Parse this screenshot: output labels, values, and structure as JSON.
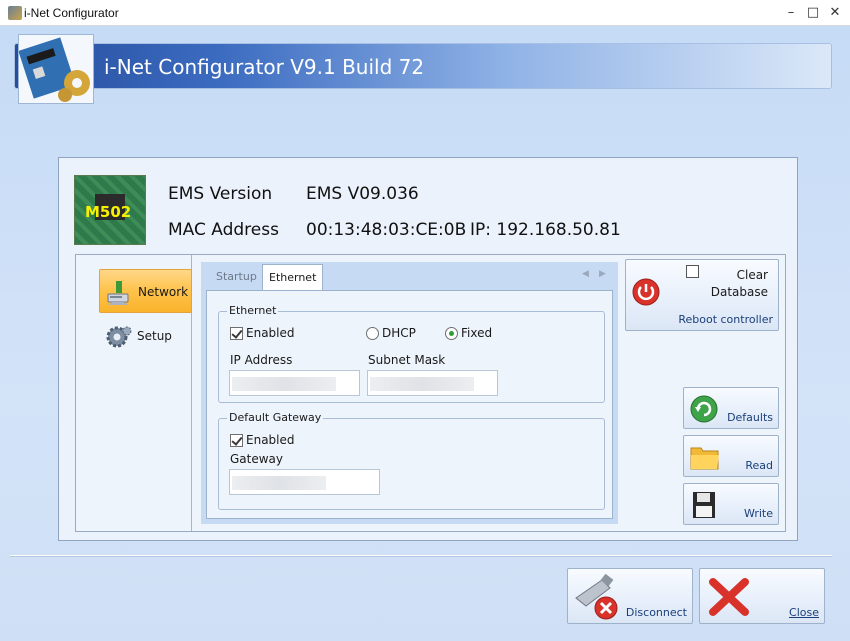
{
  "window": {
    "title": "i-Net Configurator",
    "min_glyph": "–",
    "max_glyph": "□",
    "close_glyph": "✕"
  },
  "banner": {
    "title": "i-Net Configurator V9.1 Build 72"
  },
  "device": {
    "board_label": "M502",
    "ems_version_label": "EMS Version",
    "ems_version_value": "EMS V09.036",
    "mac_label": "MAC Address",
    "mac_value": "00:13:48:03:CE:0B",
    "ip_text": "IP: 192.168.50.81"
  },
  "sidebar": {
    "items": [
      {
        "label": "Network",
        "icon": "network-icon",
        "selected": true
      },
      {
        "label": "Setup",
        "icon": "gear-icon",
        "selected": false
      }
    ]
  },
  "tabs": [
    {
      "label": "Startup",
      "active": false
    },
    {
      "label": "Ethernet",
      "active": true
    }
  ],
  "ethernet": {
    "group_title": "Ethernet",
    "enabled_label": "Enabled",
    "enabled": true,
    "dhcp_label": "DHCP",
    "fixed_label": "Fixed",
    "mode": "Fixed",
    "ip_label": "IP Address",
    "subnet_label": "Subnet Mask",
    "ip_value": "",
    "subnet_value": ""
  },
  "gateway": {
    "group_title": "Default Gateway",
    "enabled_label": "Enabled",
    "enabled": true,
    "gateway_label": "Gateway",
    "gateway_value": ""
  },
  "actions": {
    "clear_database_label": "Clear Database",
    "reboot_label": "Reboot controller",
    "defaults_label": "Defaults",
    "read_label": "Read",
    "write_label": "Write",
    "disconnect_label": "Disconnect",
    "close_label": "Close"
  },
  "colors": {
    "banner_start": "#274e9d",
    "selected_nav": "#ffc24a",
    "button_text": "#1a3f7a",
    "close_x": "#d8322b"
  }
}
